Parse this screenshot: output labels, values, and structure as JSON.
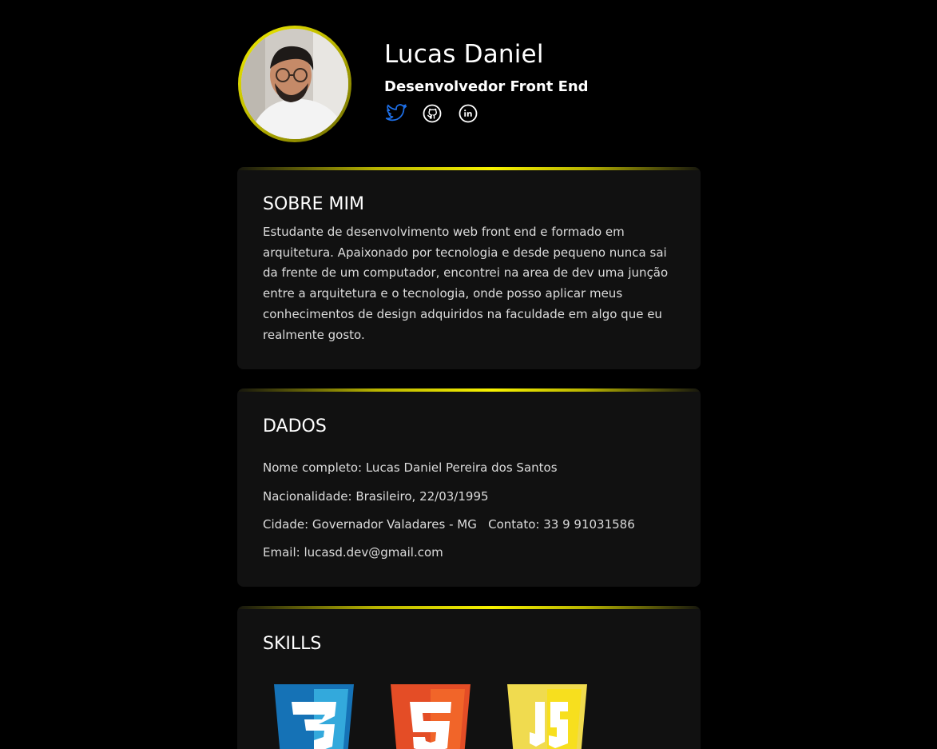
{
  "profile": {
    "name": "Lucas Daniel",
    "role": "Desenvolvedor Front End",
    "socials": [
      "twitter-icon",
      "github-icon",
      "linkedin-icon"
    ]
  },
  "about": {
    "title": "SOBRE MIM",
    "text": "Estudante de desenvolvimento web front end e formado em arquitetura. Apaixonado por tecnologia e desde pequeno nunca sai da frente de um computador, encontrei na area de dev uma junção entre a arquitetura e o tecnologia, onde posso aplicar meus conhecimentos de design adquiridos na faculdade em algo que eu realmente gosto."
  },
  "dados": {
    "title": "DADOS",
    "full_name": "Nome completo: Lucas Daniel Pereira dos Santos",
    "nationality": "Nacionalidade: Brasileiro, 22/03/1995",
    "city_contact": "Cidade: Governador Valadares - MG   Contato: 33 9 91031586",
    "email": "Email: lucasd.dev@gmail.com"
  },
  "skills": {
    "title": "SKILLS",
    "items": [
      "css3-icon",
      "html5-icon",
      "javascript-icon"
    ]
  },
  "colors": {
    "accent": "#f7f200",
    "card_bg": "#111111",
    "twitter": "#1d6fe8",
    "css3": "#1572b6",
    "html5": "#e44d26",
    "js": "#f0db4f"
  }
}
